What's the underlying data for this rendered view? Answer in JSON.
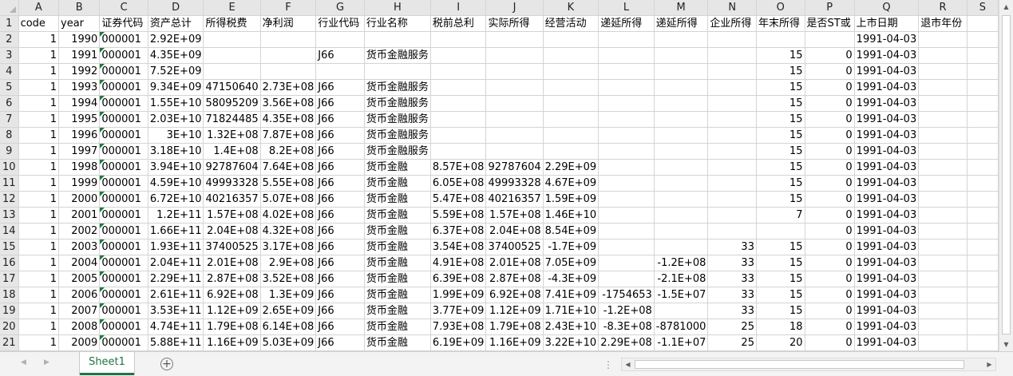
{
  "columns": [
    "A",
    "B",
    "C",
    "D",
    "E",
    "F",
    "G",
    "H",
    "I",
    "J",
    "K",
    "L",
    "M",
    "N",
    "O",
    "P",
    "Q",
    "R",
    "S"
  ],
  "row_numbers": [
    "1",
    "2",
    "3",
    "4",
    "5",
    "6",
    "7",
    "8",
    "9",
    "10",
    "11",
    "12",
    "13",
    "14",
    "15",
    "16",
    "17",
    "18",
    "19",
    "20",
    "21"
  ],
  "headers": [
    "code",
    "year",
    "证券代码",
    "资产总计",
    "所得税费",
    "净利润",
    "行业代码",
    "行业名称",
    "税前总利",
    "实际所得",
    "经营活动",
    "递延所得",
    "递延所得",
    "企业所得",
    "年末所得",
    "是否ST或",
    "上市日期",
    "退市年份",
    ""
  ],
  "rows": [
    [
      "1",
      "1990",
      "000001",
      "2.92E+09",
      "",
      "",
      "",
      "",
      "",
      "",
      "",
      "",
      "",
      "",
      "",
      "",
      "1991-04-03",
      "",
      ""
    ],
    [
      "1",
      "1991",
      "000001",
      "4.35E+09",
      "",
      "",
      "J66",
      "货币金融服务",
      "",
      "",
      "",
      "",
      "",
      "",
      "15",
      "0",
      "1991-04-03",
      "",
      ""
    ],
    [
      "1",
      "1992",
      "000001",
      "7.52E+09",
      "",
      "",
      "",
      "",
      "",
      "",
      "",
      "",
      "",
      "",
      "15",
      "0",
      "1991-04-03",
      "",
      ""
    ],
    [
      "1",
      "1993",
      "000001",
      "9.34E+09",
      "47150640",
      "2.73E+08",
      "J66",
      "货币金融服务",
      "",
      "",
      "",
      "",
      "",
      "",
      "15",
      "0",
      "1991-04-03",
      "",
      ""
    ],
    [
      "1",
      "1994",
      "000001",
      "1.55E+10",
      "58095209",
      "3.56E+08",
      "J66",
      "货币金融服务",
      "",
      "",
      "",
      "",
      "",
      "",
      "15",
      "0",
      "1991-04-03",
      "",
      ""
    ],
    [
      "1",
      "1995",
      "000001",
      "2.03E+10",
      "71824485",
      "4.35E+08",
      "J66",
      "货币金融服务",
      "",
      "",
      "",
      "",
      "",
      "",
      "15",
      "0",
      "1991-04-03",
      "",
      ""
    ],
    [
      "1",
      "1996",
      "000001",
      "3E+10",
      "1.32E+08",
      "7.87E+08",
      "J66",
      "货币金融服务",
      "",
      "",
      "",
      "",
      "",
      "",
      "15",
      "0",
      "1991-04-03",
      "",
      ""
    ],
    [
      "1",
      "1997",
      "000001",
      "3.18E+10",
      "1.4E+08",
      "8.2E+08",
      "J66",
      "货币金融服务",
      "",
      "",
      "",
      "",
      "",
      "",
      "15",
      "0",
      "1991-04-03",
      "",
      ""
    ],
    [
      "1",
      "1998",
      "000001",
      "3.94E+10",
      "92787604",
      "7.64E+08",
      "J66",
      "货币金融",
      "8.57E+08",
      "92787604",
      "2.29E+09",
      "",
      "",
      "",
      "15",
      "0",
      "1991-04-03",
      "",
      ""
    ],
    [
      "1",
      "1999",
      "000001",
      "4.59E+10",
      "49993328",
      "5.55E+08",
      "J66",
      "货币金融",
      "6.05E+08",
      "49993328",
      "4.67E+09",
      "",
      "",
      "",
      "15",
      "0",
      "1991-04-03",
      "",
      ""
    ],
    [
      "1",
      "2000",
      "000001",
      "6.72E+10",
      "40216357",
      "5.07E+08",
      "J66",
      "货币金融",
      "5.47E+08",
      "40216357",
      "1.59E+09",
      "",
      "",
      "",
      "15",
      "0",
      "1991-04-03",
      "",
      ""
    ],
    [
      "1",
      "2001",
      "000001",
      "1.2E+11",
      "1.57E+08",
      "4.02E+08",
      "J66",
      "货币金融",
      "5.59E+08",
      "1.57E+08",
      "1.46E+10",
      "",
      "",
      "",
      "7",
      "0",
      "1991-04-03",
      "",
      ""
    ],
    [
      "1",
      "2002",
      "000001",
      "1.66E+11",
      "2.04E+08",
      "4.32E+08",
      "J66",
      "货币金融",
      "6.37E+08",
      "2.04E+08",
      "8.54E+09",
      "",
      "",
      "",
      "",
      "0",
      "1991-04-03",
      "",
      ""
    ],
    [
      "1",
      "2003",
      "000001",
      "1.93E+11",
      "37400525",
      "3.17E+08",
      "J66",
      "货币金融",
      "3.54E+08",
      "37400525",
      "-1.7E+09",
      "",
      "",
      "33",
      "15",
      "0",
      "1991-04-03",
      "",
      ""
    ],
    [
      "1",
      "2004",
      "000001",
      "2.04E+11",
      "2.01E+08",
      "2.9E+08",
      "J66",
      "货币金融",
      "4.91E+08",
      "2.01E+08",
      "7.05E+09",
      "",
      "-1.2E+08",
      "33",
      "15",
      "0",
      "1991-04-03",
      "",
      ""
    ],
    [
      "1",
      "2005",
      "000001",
      "2.29E+11",
      "2.87E+08",
      "3.52E+08",
      "J66",
      "货币金融",
      "6.39E+08",
      "2.87E+08",
      "-4.3E+09",
      "",
      "-2.1E+08",
      "33",
      "15",
      "0",
      "1991-04-03",
      "",
      ""
    ],
    [
      "1",
      "2006",
      "000001",
      "2.61E+11",
      "6.92E+08",
      "1.3E+09",
      "J66",
      "货币金融",
      "1.99E+09",
      "6.92E+08",
      "7.41E+09",
      "-1754653",
      "-1.5E+07",
      "33",
      "15",
      "0",
      "1991-04-03",
      "",
      ""
    ],
    [
      "1",
      "2007",
      "000001",
      "3.53E+11",
      "1.12E+09",
      "2.65E+09",
      "J66",
      "货币金融",
      "3.77E+09",
      "1.12E+09",
      "1.71E+10",
      "-1.2E+08",
      "",
      "33",
      "15",
      "0",
      "1991-04-03",
      "",
      ""
    ],
    [
      "1",
      "2008",
      "000001",
      "4.74E+11",
      "1.79E+08",
      "6.14E+08",
      "J66",
      "货币金融",
      "7.93E+08",
      "1.79E+08",
      "2.43E+10",
      "-8.3E+08",
      "-8781000",
      "25",
      "18",
      "0",
      "1991-04-03",
      "",
      ""
    ],
    [
      "1",
      "2009",
      "000001",
      "5.88E+11",
      "1.16E+09",
      "5.03E+09",
      "J66",
      "货币金融",
      "6.19E+09",
      "1.16E+09",
      "3.22E+10",
      "2.29E+08",
      "-1.1E+07",
      "25",
      "20",
      "0",
      "1991-04-03",
      "",
      ""
    ]
  ],
  "sheet_tabs": [
    "Sheet1"
  ],
  "add_sheet_label": "+",
  "tab_nav_prev": "◀",
  "tab_nav_next": "▶",
  "more_dots": "⋮",
  "scroll_up": "▲",
  "scroll_down": "▼",
  "scroll_left": "◀",
  "scroll_right": "▶",
  "accent_color": "#217346",
  "flag_color": "#1e7a3a"
}
